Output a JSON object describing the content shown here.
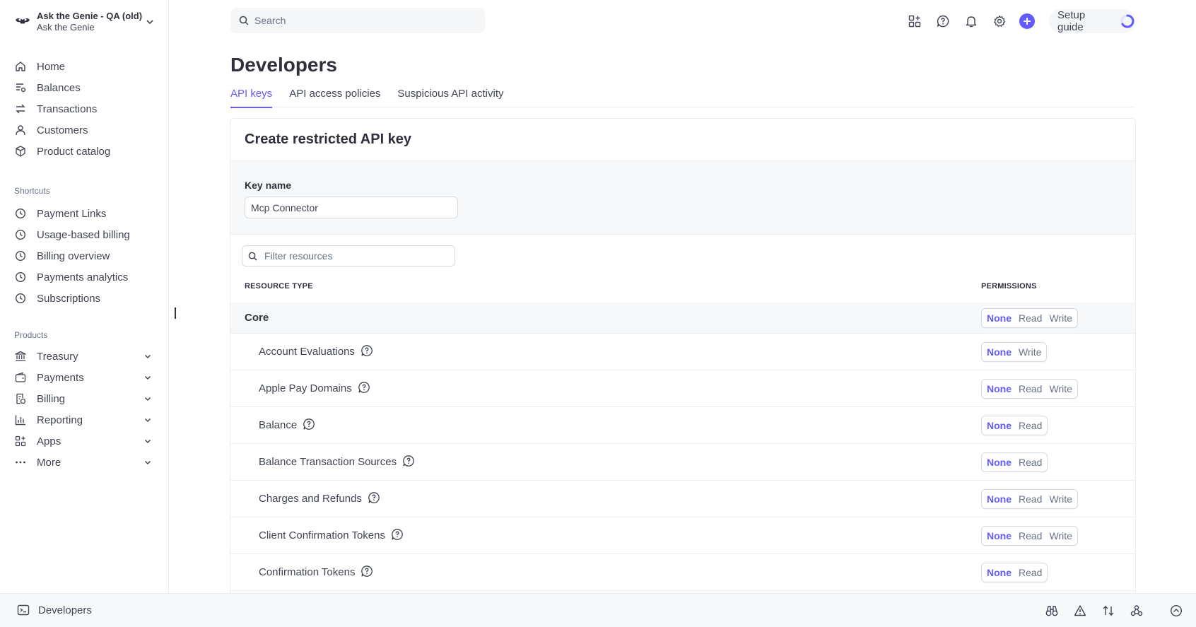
{
  "account": {
    "name": "Ask the Genie - QA (old)",
    "subtitle": "Ask the Genie"
  },
  "nav": {
    "main": [
      {
        "label": "Home",
        "icon": "home-icon"
      },
      {
        "label": "Balances",
        "icon": "balances-icon"
      },
      {
        "label": "Transactions",
        "icon": "transactions-icon"
      },
      {
        "label": "Customers",
        "icon": "customers-icon"
      },
      {
        "label": "Product catalog",
        "icon": "product-catalog-icon"
      }
    ],
    "shortcuts_title": "Shortcuts",
    "shortcuts": [
      {
        "label": "Payment Links",
        "icon": "clock-icon"
      },
      {
        "label": "Usage-based billing",
        "icon": "clock-icon"
      },
      {
        "label": "Billing overview",
        "icon": "clock-icon"
      },
      {
        "label": "Payments analytics",
        "icon": "clock-icon"
      },
      {
        "label": "Subscriptions",
        "icon": "clock-icon"
      }
    ],
    "products_title": "Products",
    "products": [
      {
        "label": "Treasury",
        "icon": "bank-icon"
      },
      {
        "label": "Payments",
        "icon": "wallet-icon"
      },
      {
        "label": "Billing",
        "icon": "billing-icon"
      },
      {
        "label": "Reporting",
        "icon": "bar-chart-icon"
      },
      {
        "label": "Apps",
        "icon": "apps-icon"
      },
      {
        "label": "More",
        "icon": "more-icon"
      }
    ]
  },
  "search": {
    "placeholder": "Search"
  },
  "topbar": {
    "setup_label": "Setup guide"
  },
  "page": {
    "title": "Developers",
    "tabs": [
      {
        "label": "API keys",
        "active": true
      },
      {
        "label": "API access policies",
        "active": false
      },
      {
        "label": "Suspicious API activity",
        "active": false
      }
    ]
  },
  "card": {
    "title": "Create restricted API key",
    "key_name_label": "Key name",
    "key_name_value": "Mcp Connector",
    "filter_placeholder": "Filter resources",
    "col_resource": "Resource type",
    "col_permissions": "Permissions",
    "rows": [
      {
        "name": "Core",
        "group": true,
        "options": [
          "None",
          "Read",
          "Write"
        ],
        "selected": "None"
      },
      {
        "name": "Account Evaluations",
        "options": [
          "None",
          "Write"
        ],
        "selected": "None"
      },
      {
        "name": "Apple Pay Domains",
        "options": [
          "None",
          "Read",
          "Write"
        ],
        "selected": "None"
      },
      {
        "name": "Balance",
        "options": [
          "None",
          "Read"
        ],
        "selected": "None"
      },
      {
        "name": "Balance Transaction Sources",
        "options": [
          "None",
          "Read"
        ],
        "selected": "None"
      },
      {
        "name": "Charges and Refunds",
        "options": [
          "None",
          "Read",
          "Write"
        ],
        "selected": "None"
      },
      {
        "name": "Client Confirmation Tokens",
        "options": [
          "None",
          "Read",
          "Write"
        ],
        "selected": "None"
      },
      {
        "name": "Confirmation Tokens",
        "options": [
          "None",
          "Read"
        ],
        "selected": "None"
      }
    ]
  },
  "bottombar": {
    "developers_label": "Developers"
  },
  "colors": {
    "accent": "#635bff",
    "text": "#30313d",
    "muted": "#687385",
    "border": "#ebeef1"
  }
}
